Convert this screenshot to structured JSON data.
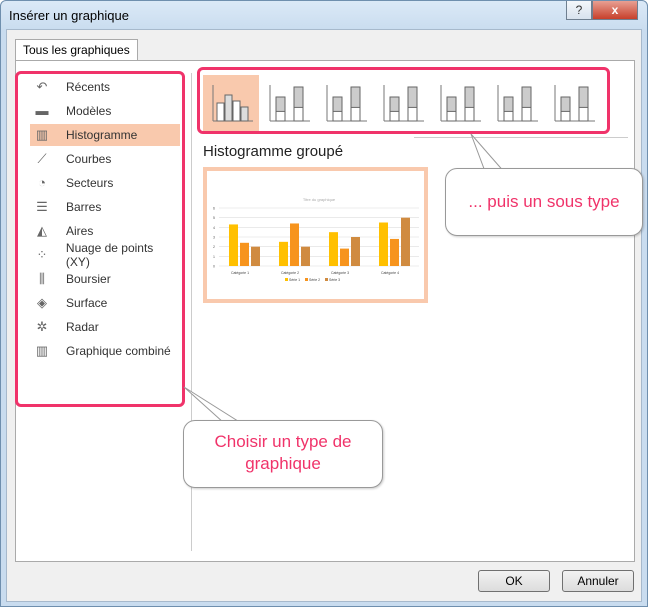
{
  "window": {
    "title": "Insérer un graphique",
    "help": "?",
    "close": "x"
  },
  "tab": "Tous les graphiques",
  "sidebar": {
    "items": [
      {
        "label": "Récents",
        "icon": "undo-icon",
        "glyph": "↶"
      },
      {
        "label": "Modèles",
        "icon": "folder-icon",
        "glyph": "▬"
      },
      {
        "label": "Histogramme",
        "icon": "column-chart-icon",
        "glyph": "▥",
        "selected": true
      },
      {
        "label": "Courbes",
        "icon": "line-chart-icon",
        "glyph": "⟋"
      },
      {
        "label": "Secteurs",
        "icon": "pie-chart-icon",
        "glyph": "◔"
      },
      {
        "label": "Barres",
        "icon": "bar-chart-icon",
        "glyph": "☰"
      },
      {
        "label": "Aires",
        "icon": "area-chart-icon",
        "glyph": "◭"
      },
      {
        "label": "Nuage de points (XY)",
        "icon": "scatter-chart-icon",
        "glyph": "⁘"
      },
      {
        "label": "Boursier",
        "icon": "stock-chart-icon",
        "glyph": "⫼"
      },
      {
        "label": "Surface",
        "icon": "surface-chart-icon",
        "glyph": "◈"
      },
      {
        "label": "Radar",
        "icon": "radar-chart-icon",
        "glyph": "✲"
      },
      {
        "label": "Graphique combiné",
        "icon": "combo-chart-icon",
        "glyph": "▥"
      }
    ]
  },
  "subtype_title": "Histogramme groupé",
  "callouts": {
    "subtype": "... puis un sous type",
    "type": "Choisir un type de graphique"
  },
  "buttons": {
    "ok": "OK",
    "cancel": "Annuler"
  },
  "colors": {
    "selection": "#f9c9ad",
    "highlight": "#f0336a",
    "series": [
      "#ffc000",
      "#f7941d",
      "#d08b40"
    ]
  },
  "chart_data": {
    "type": "bar",
    "title": "Titre du graphique",
    "categories": [
      "Catégorie 1",
      "Catégorie 2",
      "Catégorie 3",
      "Catégorie 4"
    ],
    "series": [
      {
        "name": "Série 1",
        "values": [
          4.3,
          2.5,
          3.5,
          4.5
        ]
      },
      {
        "name": "Série 2",
        "values": [
          2.4,
          4.4,
          1.8,
          2.8
        ]
      },
      {
        "name": "Série 3",
        "values": [
          2,
          2,
          3,
          5
        ]
      }
    ],
    "yticks": [
      "0",
      "1",
      "2",
      "3",
      "4",
      "5",
      "6"
    ],
    "ylim": [
      0,
      6
    ],
    "grid": true,
    "legend": "bottom"
  }
}
